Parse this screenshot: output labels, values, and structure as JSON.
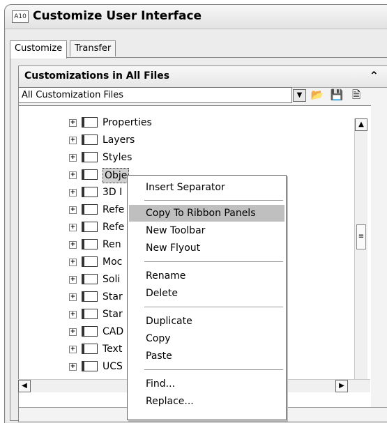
{
  "window": {
    "title": "Customize User Interface",
    "app_icon_text": "A10"
  },
  "tabs": [
    {
      "label": "Customize"
    },
    {
      "label": "Transfer"
    }
  ],
  "panel": {
    "title": "Customizations in All Files",
    "combo_value": "All Customization Files"
  },
  "icons": {
    "collapse": "double-chevron-up-icon",
    "dropdown": "chevron-down-icon",
    "open": "open-folder-icon",
    "save": "save-icon",
    "load": "load-partial-icon"
  },
  "tree": {
    "items": [
      {
        "label": "Properties"
      },
      {
        "label": "Layers"
      },
      {
        "label": "Styles"
      },
      {
        "label": "Obje"
      },
      {
        "label": "3D I"
      },
      {
        "label": "Refe"
      },
      {
        "label": "Refe"
      },
      {
        "label": "Ren"
      },
      {
        "label": "Moc"
      },
      {
        "label": "Soli"
      },
      {
        "label": "Star"
      },
      {
        "label": "Star"
      },
      {
        "label": "CAD"
      },
      {
        "label": "Text"
      },
      {
        "label": "UCS"
      }
    ]
  },
  "context_menu": {
    "items": [
      {
        "label": "Insert Separator"
      },
      {
        "label": "Copy To Ribbon Panels"
      },
      {
        "label": "New Toolbar"
      },
      {
        "label": "New Flyout"
      },
      {
        "label": "Rename"
      },
      {
        "label": "Delete"
      },
      {
        "label": "Duplicate"
      },
      {
        "label": "Copy"
      },
      {
        "label": "Paste"
      },
      {
        "label": "Find..."
      },
      {
        "label": "Replace..."
      }
    ]
  }
}
